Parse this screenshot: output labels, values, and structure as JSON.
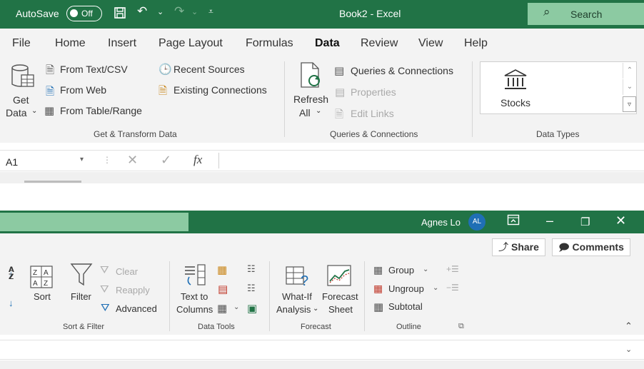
{
  "top_window": {
    "autosave_label": "AutoSave",
    "autosave_state": "Off",
    "book_title": "Book2  -  Excel",
    "search_label": "Search",
    "menu": [
      "File",
      "Home",
      "Insert",
      "Page Layout",
      "Formulas",
      "Data",
      "Review",
      "View",
      "Help"
    ],
    "active_tab": "Data",
    "get_transform": {
      "get_data_line1": "Get",
      "get_data_line2": "Data",
      "from_text_csv": "From Text/CSV",
      "from_web": "From Web",
      "from_table_range": "From Table/Range",
      "recent_sources": "Recent Sources",
      "existing_connections": "Existing Connections",
      "group_label": "Get & Transform Data"
    },
    "queries": {
      "refresh_line1": "Refresh",
      "refresh_line2": "All",
      "queries_connections": "Queries & Connections",
      "properties": "Properties",
      "edit_links": "Edit Links",
      "group_label": "Queries & Connections"
    },
    "data_types": {
      "stocks": "Stocks",
      "group_label": "Data Types"
    },
    "formula_bar": {
      "name_box": "A1",
      "fx": "fx"
    }
  },
  "bottom_window": {
    "user_name": "Agnes Lo",
    "avatar_initials": "AL",
    "share_label": "Share",
    "comments_label": "Comments",
    "sort_filter": {
      "sort": "Sort",
      "filter": "Filter",
      "clear": "Clear",
      "reapply": "Reapply",
      "advanced": "Advanced",
      "group_label": "Sort & Filter"
    },
    "data_tools": {
      "text_to_line1": "Text to",
      "text_to_line2": "Columns",
      "group_label": "Data Tools"
    },
    "forecast": {
      "what_if_line1": "What-If",
      "what_if_line2": "Analysis",
      "forecast_line1": "Forecast",
      "forecast_line2": "Sheet",
      "group_label": "Forecast"
    },
    "outline": {
      "group": "Group",
      "ungroup": "Ungroup",
      "subtotal": "Subtotal",
      "group_label": "Outline"
    }
  },
  "colors": {
    "excel_green": "#217346",
    "search_green": "#8ccaa2",
    "ribbon_bg": "#f3f3f3",
    "avatar_blue": "#1f6fb5"
  }
}
